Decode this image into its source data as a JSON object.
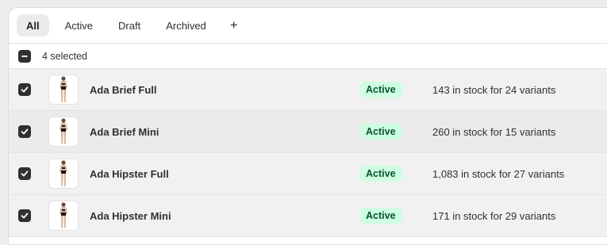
{
  "tabs": [
    {
      "label": "All",
      "selected": true
    },
    {
      "label": "Active",
      "selected": false
    },
    {
      "label": "Draft",
      "selected": false
    },
    {
      "label": "Archived",
      "selected": false
    }
  ],
  "add_tab_label": "+",
  "bulk_bar": {
    "selected_text": "4 selected"
  },
  "products": [
    {
      "name": "Ada Brief Full",
      "status": "Active",
      "inventory": "143 in stock for 24 variants",
      "checked": true
    },
    {
      "name": "Ada Brief Mini",
      "status": "Active",
      "inventory": "260 in stock for 15 variants",
      "checked": true
    },
    {
      "name": "Ada Hipster Full",
      "status": "Active",
      "inventory": "1,083 in stock for 27 variants",
      "checked": true
    },
    {
      "name": "Ada Hipster Mini",
      "status": "Active",
      "inventory": "171 in stock for 29 variants",
      "checked": true
    }
  ],
  "colors": {
    "checkbox_fill": "#303030",
    "badge_bg": "#cdfee1",
    "badge_text": "#0c5132",
    "row_bg": "#f1f1f1"
  }
}
